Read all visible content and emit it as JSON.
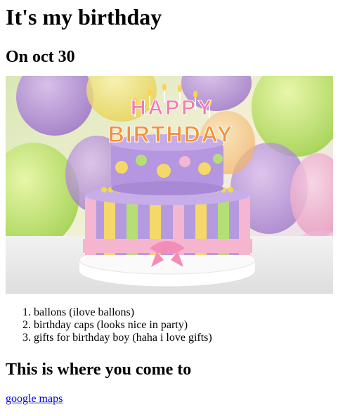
{
  "page": {
    "title": "It's my birthday",
    "date_heading": "On oct 30",
    "image": {
      "cake_topper_line1": "HAPPY",
      "cake_topper_line2": "BIRTHDAY"
    },
    "gift_list": [
      "ballons (ilove ballons)",
      "birthday caps (looks nice in party)",
      "gifts for birthday boy (haha i love gifts)"
    ],
    "location_heading": "This is where you come to",
    "maps_link": "google maps"
  }
}
